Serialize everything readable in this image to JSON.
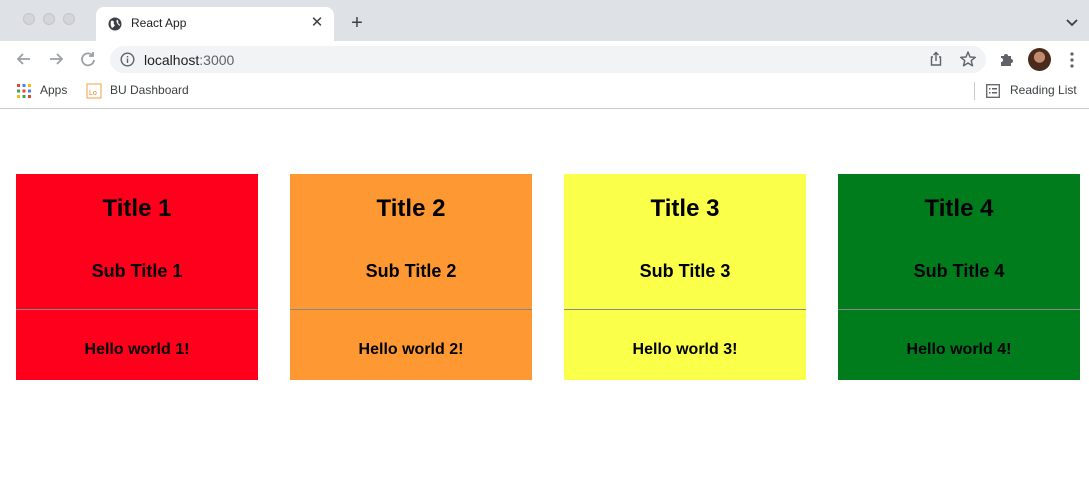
{
  "browser": {
    "tab_title": "React App",
    "url_host": "localhost",
    "url_port": ":3000",
    "bookmarks": [
      {
        "label": "Apps",
        "icon": "apps-grid-icon"
      },
      {
        "label": "BU Dashboard",
        "icon": "bu-dashboard-favicon"
      }
    ],
    "reading_list_label": "Reading List"
  },
  "cards": [
    {
      "title": "Title 1",
      "subtitle": "Sub Title 1",
      "body": "Hello world 1!",
      "color": "#ff001c"
    },
    {
      "title": "Title 2",
      "subtitle": "Sub Title 2",
      "body": "Hello world 2!",
      "color": "#fe9833"
    },
    {
      "title": "Title 3",
      "subtitle": "Sub Title 3",
      "body": "Hello world 3!",
      "color": "#faff4a"
    },
    {
      "title": "Title 4",
      "subtitle": "Sub Title 4",
      "body": "Hello world 4!",
      "color": "#007c1c"
    }
  ]
}
